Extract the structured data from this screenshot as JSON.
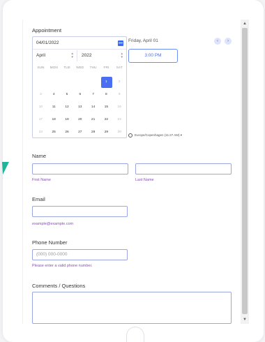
{
  "form": {
    "appointment_label": "Appointment",
    "date_value": "04/01/2022",
    "month_value": "April",
    "year_value": "2022",
    "weekdays": [
      "SUN",
      "MON",
      "TUE",
      "WED",
      "THU",
      "FRI",
      "SAT"
    ],
    "weeks": [
      [
        "",
        "",
        "",
        "",
        "",
        "1",
        "2"
      ],
      [
        "3",
        "4",
        "5",
        "6",
        "7",
        "8",
        "9"
      ],
      [
        "10",
        "11",
        "12",
        "13",
        "14",
        "15",
        "16"
      ],
      [
        "17",
        "18",
        "19",
        "20",
        "21",
        "22",
        "23"
      ],
      [
        "24",
        "25",
        "26",
        "27",
        "28",
        "29",
        "30"
      ]
    ],
    "selected_day_label": "Friday, April 01",
    "time_slot": "3:00 PM",
    "timezone": "Europe/Copenhagen (11:27 AM)",
    "name_label": "Name",
    "first_name_sublabel": "First Name",
    "last_name_sublabel": "Last Name",
    "email_label": "Email",
    "email_sublabel": "example@example.com",
    "phone_label": "Phone Number",
    "phone_placeholder": "(000) 000-0000",
    "phone_sublabel": "Please enter a valid phone number.",
    "comments_label": "Comments / Questions",
    "prev_icon": "chevron-left-icon",
    "next_icon": "chevron-right-icon"
  },
  "colors": {
    "accent": "#4a6ff3",
    "sublabel": "#8a4fb8",
    "field_border": "#9aa7e0",
    "corner_mark": "#1fb59a"
  }
}
